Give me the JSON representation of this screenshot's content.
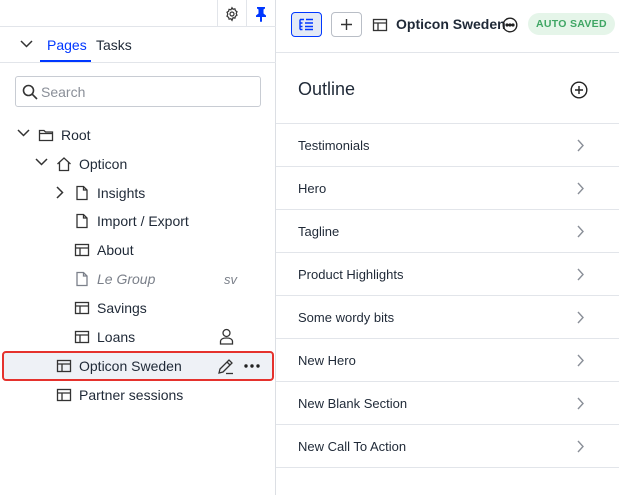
{
  "left_panel": {
    "tabs": [
      {
        "label": "Pages",
        "active": true
      },
      {
        "label": "Tasks",
        "active": false
      }
    ],
    "search": {
      "placeholder": "Search",
      "value": ""
    },
    "tree": [
      {
        "label": "Root",
        "icon": "folder-icon",
        "expanded": true
      },
      {
        "label": "Opticon",
        "icon": "home-icon",
        "expanded": true
      },
      {
        "label": "Insights",
        "icon": "page-icon",
        "expanded": false
      },
      {
        "label": "Import / Export",
        "icon": "page-icon"
      },
      {
        "label": "About",
        "icon": "layout-icon"
      },
      {
        "label": "Le Group",
        "icon": "page-icon",
        "lang": "sv",
        "muted": true
      },
      {
        "label": "Savings",
        "icon": "layout-icon"
      },
      {
        "label": "Loans",
        "icon": "layout-icon",
        "extra_icon": "user-icon"
      },
      {
        "label": "Opticon Sweden",
        "icon": "layout-icon",
        "selected": true
      },
      {
        "label": "Partner sessions",
        "icon": "layout-icon"
      }
    ]
  },
  "right_panel": {
    "page_name": "Opticon Sweden",
    "status_badge": "AUTO SAVED",
    "outline_title": "Outline",
    "sections": [
      "Testimonials",
      "Hero",
      "Tagline",
      "Product Highlights",
      "Some wordy bits",
      "New Hero",
      "New Blank Section",
      "New Call To Action"
    ]
  },
  "colors": {
    "accent": "#0037ff",
    "selection_border": "#e5322d",
    "badge_bg": "#e5f5e9",
    "badge_text": "#3fa664"
  }
}
